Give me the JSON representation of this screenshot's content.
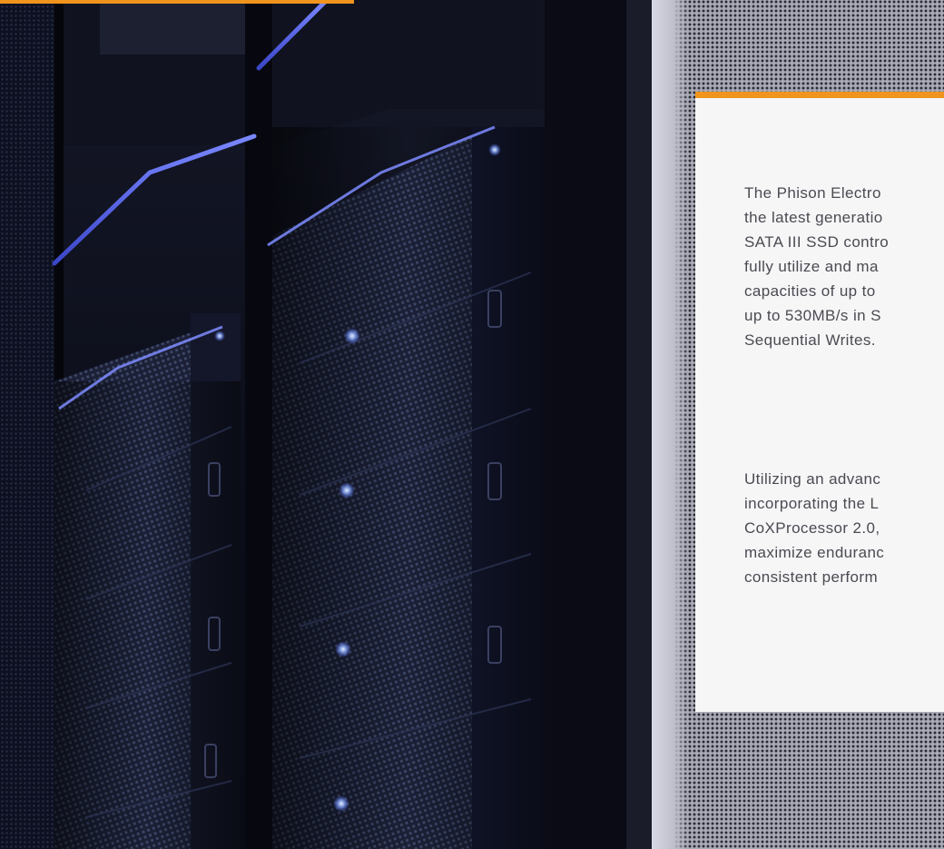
{
  "card": {
    "accent_color": "#f0941d",
    "paragraph_1": [
      "The Phison Electro",
      "the latest generatio",
      "SATA III SSD contro",
      "fully utilize and ma",
      "capacities of up to",
      "up to 530MB/s in S",
      "Sequential Writes."
    ],
    "paragraph_2": [
      "Utilizing an advanc",
      "incorporating the L",
      "CoXProcessor 2.0,",
      "maximize enduranc",
      "consistent perform"
    ]
  }
}
